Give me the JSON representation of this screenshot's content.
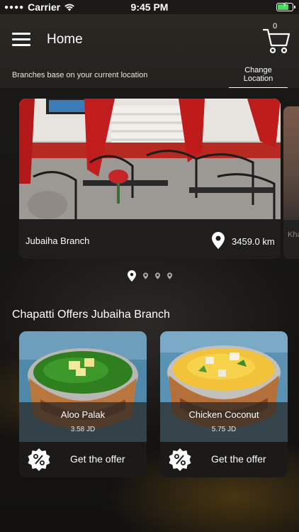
{
  "status_bar": {
    "carrier": "Carrier",
    "time": "9:45 PM"
  },
  "header": {
    "title": "Home",
    "cart_count": "0",
    "location_note": "Branches base on your current location",
    "change_location": "Change Location"
  },
  "branches": [
    {
      "name": "Jubaiha Branch",
      "distance": "3459.0 km"
    },
    {
      "name": "Kha"
    }
  ],
  "pager": {
    "count": 4,
    "active": 0
  },
  "offers_section": {
    "title": "Chapatti Offers Jubaiha Branch",
    "items": [
      {
        "name": "Aloo Palak",
        "price": "3.58 JD",
        "cta": "Get the offer"
      },
      {
        "name": "Chicken Coconut",
        "price": "5.75 JD",
        "cta": "Get the offer"
      }
    ]
  }
}
